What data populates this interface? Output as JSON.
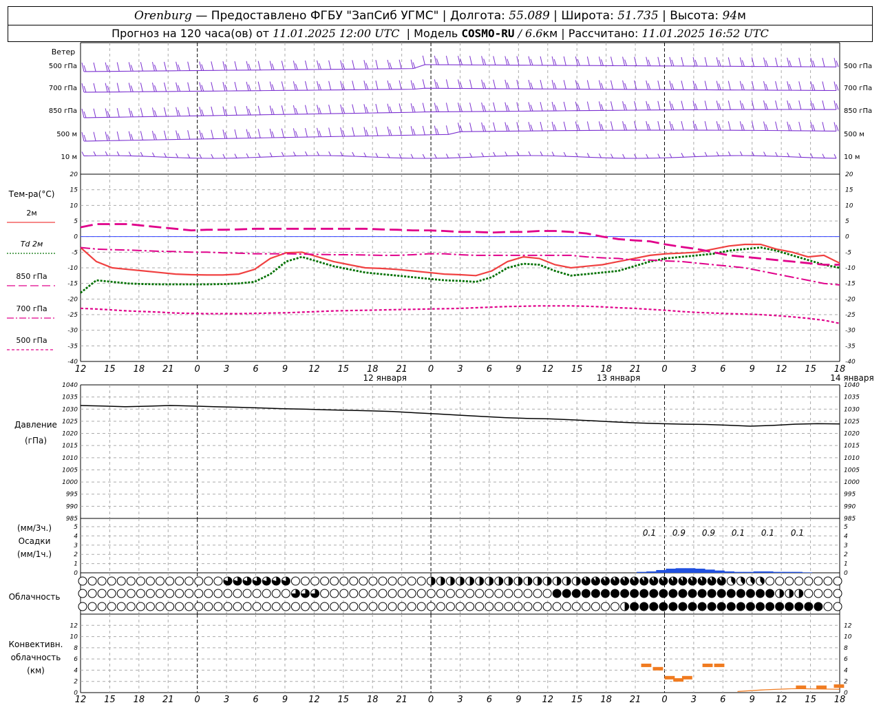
{
  "header": {
    "row1": {
      "station": "Orenburg",
      "provider": "— Предоставлено ФГБУ \"ЗапСиб УГМС\"",
      "lon_label": "Долгота:",
      "lon_value": "55.089",
      "lat_label": "Широта:",
      "lat_value": "51.735",
      "alt_label": "Высота:",
      "alt_value": "94",
      "alt_unit": "м"
    },
    "row2": {
      "forecast_label": "Прогноз на 120 часа(ов) от",
      "forecast_time": "11.01.2025 12:00 UTC",
      "model_label": "Модель",
      "model_name": "COSMO-RU",
      "model_res": "/ 6.6",
      "model_res_unit": "км",
      "calc_label": "Рассчитано:",
      "calc_time": "11.01.2025 16:52 UTC"
    }
  },
  "chart_data": {
    "type": "meteogram",
    "x_ticks": [
      "12",
      "15",
      "18",
      "21",
      "0",
      "3",
      "6",
      "9",
      "12",
      "15",
      "18",
      "21",
      "0",
      "3",
      "6",
      "9",
      "12",
      "15",
      "18",
      "21",
      "0",
      "3",
      "6",
      "9",
      "12",
      "15",
      "18"
    ],
    "dates": [
      "12 января",
      "13 января",
      "14 января"
    ],
    "wind": {
      "title": "Ветер",
      "levels": [
        "500 гПа",
        "700 гПа",
        "850 гПа",
        "500 м",
        "10 м"
      ]
    },
    "temperature": {
      "title": "Тем-ра(°С)",
      "ylim": [
        -40,
        20
      ],
      "yticks": [
        20,
        15,
        10,
        5,
        0,
        -5,
        -10,
        -15,
        -20,
        -25,
        -30,
        -35,
        -40
      ],
      "legend": [
        {
          "label": "2м",
          "color": "#f04040",
          "dash": "solid"
        },
        {
          "label": "Td 2м",
          "color": "#007000",
          "dash": "dotted"
        },
        {
          "label": "850 гПа",
          "color": "#e0008a",
          "dash": "long-dash"
        },
        {
          "label": "700 гПа",
          "color": "#e0008a",
          "dash": "dash-dot"
        },
        {
          "label": "500 гПа",
          "color": "#e0008a",
          "dash": "short-dash"
        }
      ],
      "series": [
        {
          "name": "2м",
          "values": [
            -3.5,
            -8,
            -10,
            -10.5,
            -11,
            -11.5,
            -12,
            -12.2,
            -12.3,
            -12.3,
            -12,
            -10.5,
            -7,
            -5.2,
            -5,
            -6.5,
            -8,
            -9,
            -10,
            -10.2,
            -10.5,
            -11,
            -11.5,
            -12,
            -12.2,
            -12.5,
            -11,
            -8,
            -6.5,
            -7,
            -9,
            -10,
            -9.5,
            -9,
            -8,
            -7,
            -6,
            -5.5,
            -5.3,
            -5,
            -4,
            -3,
            -2.5,
            -2.5,
            -4,
            -5,
            -6.5,
            -6,
            -8.5
          ]
        },
        {
          "name": "Td 2м",
          "values": [
            -18,
            -14,
            -14.5,
            -15,
            -15.2,
            -15.3,
            -15.3,
            -15.3,
            -15.3,
            -15.2,
            -15,
            -14.5,
            -12,
            -8,
            -6.5,
            -8,
            -9.5,
            -10.5,
            -11.5,
            -12,
            -12.5,
            -13,
            -13.5,
            -14,
            -14.2,
            -14.5,
            -13,
            -10,
            -8.7,
            -9,
            -11,
            -12.5,
            -12,
            -11.5,
            -11,
            -9.5,
            -8,
            -7,
            -6.5,
            -6,
            -5.5,
            -4.5,
            -4,
            -3.5,
            -4.5,
            -6,
            -7.5,
            -9,
            -10
          ]
        },
        {
          "name": "850 гПа",
          "values": [
            3,
            4,
            4,
            4,
            3.5,
            3,
            2.5,
            2,
            2.2,
            2.2,
            2.3,
            2.5,
            2.5,
            2.5,
            2.5,
            2.5,
            2.5,
            2.5,
            2.5,
            2.3,
            2.2,
            2,
            2,
            1.8,
            1.5,
            1.5,
            1.3,
            1.5,
            1.5,
            1.8,
            1.8,
            1.5,
            1,
            0,
            -0.8,
            -1.2,
            -1.5,
            -2.5,
            -3.3,
            -4,
            -5,
            -6,
            -6.5,
            -7,
            -7.5,
            -8,
            -8.5,
            -9,
            -9
          ]
        },
        {
          "name": "700 гПа",
          "values": [
            -3.5,
            -4,
            -4.2,
            -4.3,
            -4.5,
            -4.7,
            -4.8,
            -5,
            -5,
            -5.2,
            -5.3,
            -5.5,
            -5.5,
            -5.5,
            -5.6,
            -5.7,
            -5.8,
            -5.8,
            -5.9,
            -6,
            -6,
            -5.8,
            -5.5,
            -5.5,
            -5.8,
            -6,
            -6,
            -6,
            -6,
            -6,
            -6,
            -6,
            -6.5,
            -6.8,
            -7,
            -7.5,
            -7.5,
            -7.8,
            -8,
            -8.5,
            -9,
            -9.5,
            -10,
            -11,
            -12,
            -13,
            -14,
            -15,
            -15.5
          ]
        },
        {
          "name": "500 гПа",
          "values": [
            -23,
            -23.2,
            -23.5,
            -23.8,
            -24,
            -24.2,
            -24.5,
            -24.6,
            -24.7,
            -24.7,
            -24.7,
            -24.6,
            -24.5,
            -24.4,
            -24.2,
            -24,
            -23.8,
            -23.7,
            -23.6,
            -23.5,
            -23.4,
            -23.3,
            -23.2,
            -23.1,
            -23,
            -22.8,
            -22.6,
            -22.4,
            -22.3,
            -22.2,
            -22.2,
            -22.2,
            -22.3,
            -22.5,
            -22.8,
            -23,
            -23.3,
            -23.6,
            -24,
            -24.3,
            -24.5,
            -24.7,
            -24.8,
            -25,
            -25.3,
            -25.7,
            -26.2,
            -26.8,
            -27.8
          ]
        }
      ]
    },
    "pressure": {
      "title": "Давление",
      "unit": "(гПа)",
      "ylim": [
        985,
        1040
      ],
      "yticks": [
        1040,
        1035,
        1030,
        1025,
        1020,
        1015,
        1010,
        1005,
        1000,
        995,
        990,
        985
      ],
      "values": [
        1031.5,
        1031.3,
        1031,
        1031.2,
        1031.5,
        1031.3,
        1031,
        1030.8,
        1030.5,
        1030.2,
        1030,
        1029.7,
        1029.5,
        1029.3,
        1029,
        1028.5,
        1028,
        1027.5,
        1027,
        1026.5,
        1026.2,
        1026,
        1025.6,
        1025.2,
        1024.7,
        1024.3,
        1024,
        1023.8,
        1023.7,
        1023.4,
        1023,
        1023.3,
        1023.8,
        1024,
        1023.9
      ]
    },
    "precip": {
      "title": "Осадки",
      "unit_top": "(мм/3ч.)",
      "unit_bottom": "(мм/1ч.)",
      "ylim": [
        0,
        5
      ],
      "yticks": [
        5,
        4,
        3,
        2,
        1,
        0
      ],
      "labels_3h": [
        "0.1",
        "0.9",
        "0.9",
        "0.1",
        "0.1",
        "0.1"
      ],
      "values_1h": [
        0.1,
        0.15,
        0.3,
        0.45,
        0.5,
        0.5,
        0.45,
        0.35,
        0.25,
        0.15,
        0.1,
        0.1,
        0.15,
        0.15,
        0.1,
        0.1,
        0.1,
        0.05
      ]
    },
    "cloud": {
      "title": "Облачность",
      "rows": 3
    },
    "convective": {
      "title_lines": [
        "Конвективн.",
        "облачность",
        "(км)"
      ],
      "ylim": [
        0,
        14
      ],
      "yticks": [
        12,
        10,
        8,
        6,
        4,
        2,
        0
      ]
    }
  }
}
